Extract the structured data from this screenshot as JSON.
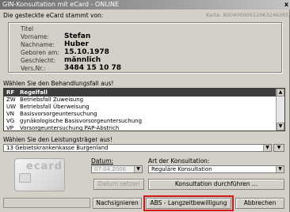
{
  "window": {
    "title": "GIN-Konsultation mit eCard - ONLINE",
    "close_glyph": "x"
  },
  "card_info": {
    "heading": "Die gesteckte eCard stammt von:",
    "card_number": "Karte: 80040000012063246265/1",
    "fields": [
      {
        "key": "Titel",
        "value": ""
      },
      {
        "key": "Vorname:",
        "value": "Stefan"
      },
      {
        "key": "Nachname:",
        "value": "Huber"
      },
      {
        "key": "Geboren am:",
        "value": "15.10.1978"
      },
      {
        "key": "Geschlecht:",
        "value": "männlich"
      },
      {
        "key": "Vers.Nr.:",
        "value": "3484 15 10 78"
      }
    ]
  },
  "behandlungsfall": {
    "label": "Wählen Sie den Behandlungsfall aus!",
    "items": [
      {
        "code": "RF",
        "label": "Regelfall",
        "selected": true
      },
      {
        "code": "ZW",
        "label": "Betriebsfall Zuweisung"
      },
      {
        "code": "UW",
        "label": "Betriebsfall Überweisung"
      },
      {
        "code": "VN",
        "label": "Basisvorsorgeuntersuchung"
      },
      {
        "code": "VG",
        "label": "gynäkologische Basisvorsorgeuntersuchung"
      },
      {
        "code": "VP",
        "label": "Vorsorgeuntersuchung PAP-Abstrich"
      }
    ]
  },
  "leistungstraeger": {
    "label": "Wählen Sie den Leistungsträger aus!",
    "selected": "13  Gebietskrankenkasse Burgenland"
  },
  "ecard_logo": "ecard",
  "datum": {
    "label": "Datum:",
    "value": "07.04.2006"
  },
  "art": {
    "label": "Art der Konsultation:",
    "value": "Reguläre Konsultation"
  },
  "buttons": {
    "datum_setzen": "Datum setzen",
    "konsultation_durchfuehren": "Konsultation durchführen ...",
    "nachsignieren": "Nachsignieren",
    "abs": "ABS - Langzeitbewilligung",
    "abbrechen": "Abbrechen"
  }
}
